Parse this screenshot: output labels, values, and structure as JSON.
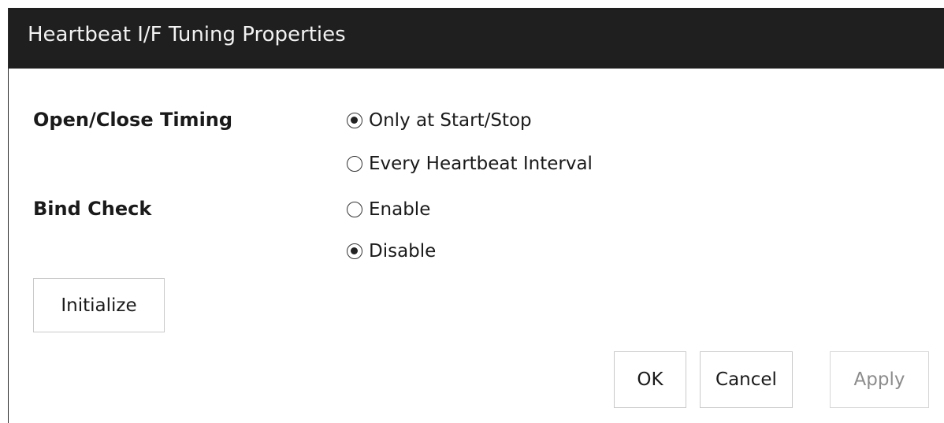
{
  "dialog": {
    "title": "Heartbeat I/F Tuning Properties"
  },
  "open_close_timing": {
    "label": "Open/Close Timing",
    "options": [
      {
        "label": "Only at Start/Stop",
        "selected": true
      },
      {
        "label": "Every Heartbeat Interval",
        "selected": false
      }
    ]
  },
  "bind_check": {
    "label": "Bind Check",
    "options": [
      {
        "label": "Enable",
        "selected": false
      },
      {
        "label": "Disable",
        "selected": true
      }
    ]
  },
  "buttons": {
    "initialize": "Initialize",
    "ok": "OK",
    "cancel": "Cancel",
    "apply": "Apply"
  },
  "states": {
    "apply_disabled": true
  }
}
